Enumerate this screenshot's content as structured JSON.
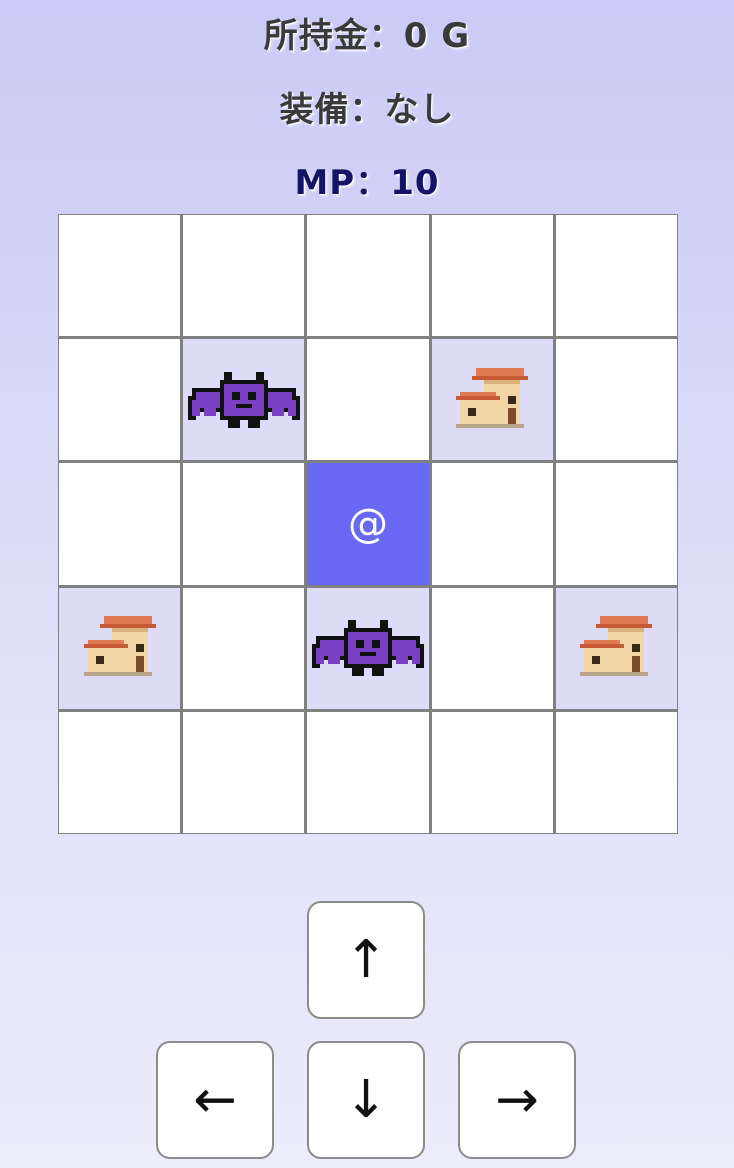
{
  "status": {
    "money": "所持金：0 G",
    "equipment": "装備：なし",
    "mp": "MP：10"
  },
  "board": {
    "rows": 5,
    "cols": 5,
    "player_symbol": "@",
    "cells": [
      [
        "",
        "",
        "",
        "",
        ""
      ],
      [
        "",
        "bat",
        "",
        "house",
        ""
      ],
      [
        "",
        "",
        "player",
        "",
        ""
      ],
      [
        "house",
        "",
        "bat",
        "",
        "house"
      ],
      [
        "",
        "",
        "",
        "",
        ""
      ]
    ]
  },
  "controls": {
    "up": "↑",
    "left": "←",
    "down": "↓",
    "right": "→"
  },
  "colors": {
    "player_cell": "#6868f4",
    "object_cell": "#dcdcf7",
    "bat": "#7b3fc4",
    "house_roof": "#e07a52",
    "house_wall": "#f3d6a6"
  },
  "icons": {
    "bat": "bat-icon",
    "house": "house-icon"
  }
}
